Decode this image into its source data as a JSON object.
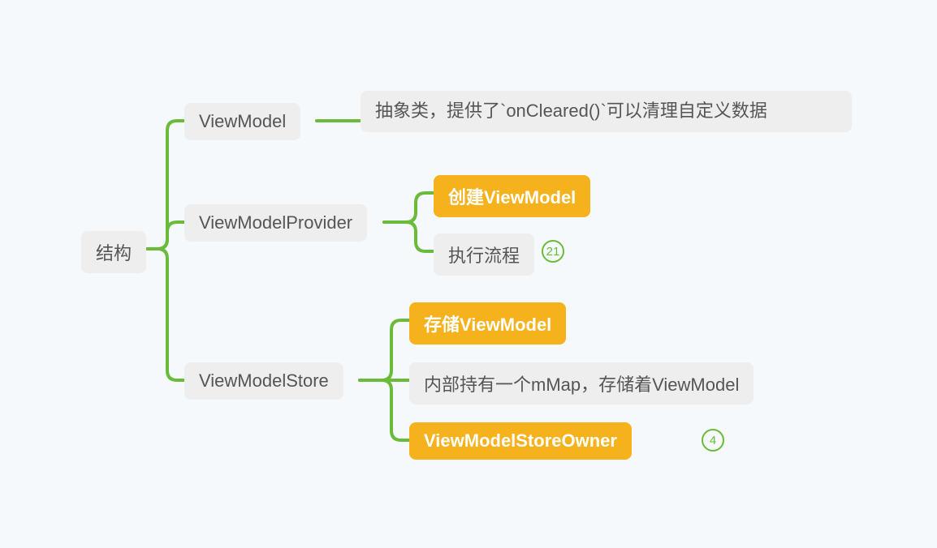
{
  "root": {
    "label": "结构"
  },
  "branches": [
    {
      "label": "ViewModel",
      "children": [
        {
          "label": "抽象类，提供了`onCleared()`可以清理自定义数据",
          "highlight": false
        }
      ]
    },
    {
      "label": "ViewModelProvider",
      "children": [
        {
          "label": "创建ViewModel",
          "highlight": true
        },
        {
          "label": "执行流程",
          "highlight": false,
          "badge": 21
        }
      ]
    },
    {
      "label": "ViewModelStore",
      "children": [
        {
          "label": "存储ViewModel",
          "highlight": true
        },
        {
          "label": "内部持有一个mMap，存储着ViewModel",
          "highlight": false
        },
        {
          "label": "ViewModelStoreOwner",
          "highlight": true,
          "badge": 4
        }
      ]
    }
  ]
}
